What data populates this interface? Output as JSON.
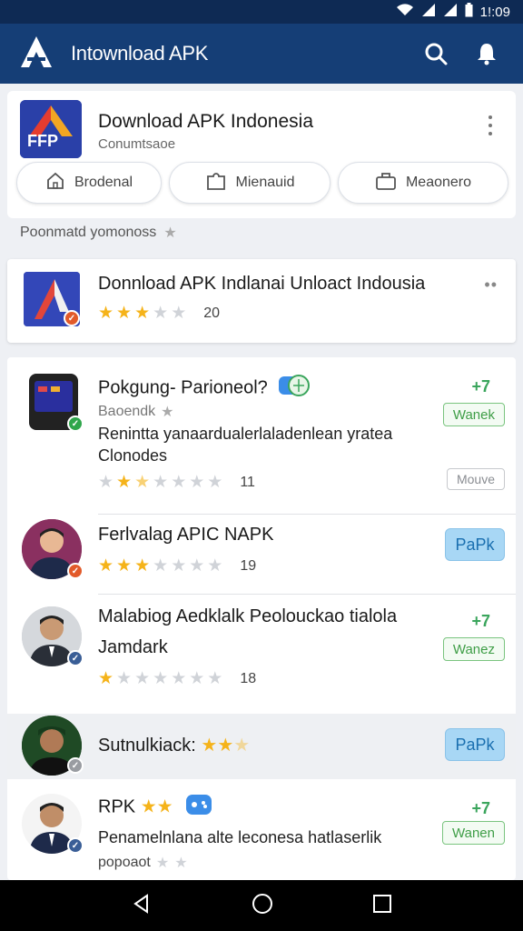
{
  "status_bar": {
    "time": "1!:09"
  },
  "app_bar": {
    "title": "Intownload APK"
  },
  "header": {
    "title": "Download APK Indonesia",
    "subtitle": "Conumtsaoe",
    "logo_text": "FFP"
  },
  "chips": [
    {
      "label": "Brodenal",
      "icon": "home-icon"
    },
    {
      "label": "Mienauid",
      "icon": "puzzle-icon"
    },
    {
      "label": "Meaonero",
      "icon": "briefcase-icon"
    }
  ],
  "section_label": "Poonmatd yomonoss",
  "featured": {
    "title": "Donnload APK Indlanai Unloact Indousia",
    "rating": 3,
    "count": "20"
  },
  "list": [
    {
      "title": "Pokgung- Parioneol?",
      "sub": "Baoendk",
      "text1": "Renintta yanaardualerlaladenlean yratea",
      "text2": "Clonodes",
      "rating": 2.5,
      "count": "11",
      "action": "Wanek",
      "secondary": "Mouve",
      "avatar": "tablet",
      "badge_color": "#2fa64b"
    },
    {
      "title": "Ferlvalag APIC NAPK",
      "rating": 3,
      "count": "19",
      "action": "PaPk",
      "avatar": "person-pink",
      "badge_color": "#e25a2a"
    },
    {
      "title": "Malabiog Aedklalk Peolouckao tialola",
      "text1": "Jamdark",
      "rating": 1,
      "count": "18",
      "action": "Wanez",
      "avatar": "person-gray",
      "badge_color": "#3a5e96"
    },
    {
      "title": "Sutnulkiack:",
      "rating": 2,
      "action": "PaPk",
      "avatar": "person-green",
      "badge_color": "#999ca1"
    },
    {
      "title": "RPK",
      "text1": "Penamelnlana alte leconesa hatlaserlik",
      "text2": "popoaot",
      "rating": 2,
      "action": "Wanen",
      "avatar": "person-white",
      "badge_color": "#3a5e96"
    }
  ],
  "up_symbol": "+7",
  "colors": {
    "app_bar": "#153e76",
    "star": "#f5b31a",
    "accent_green": "#3f9e47",
    "accent_blue": "#a8d7f5"
  }
}
